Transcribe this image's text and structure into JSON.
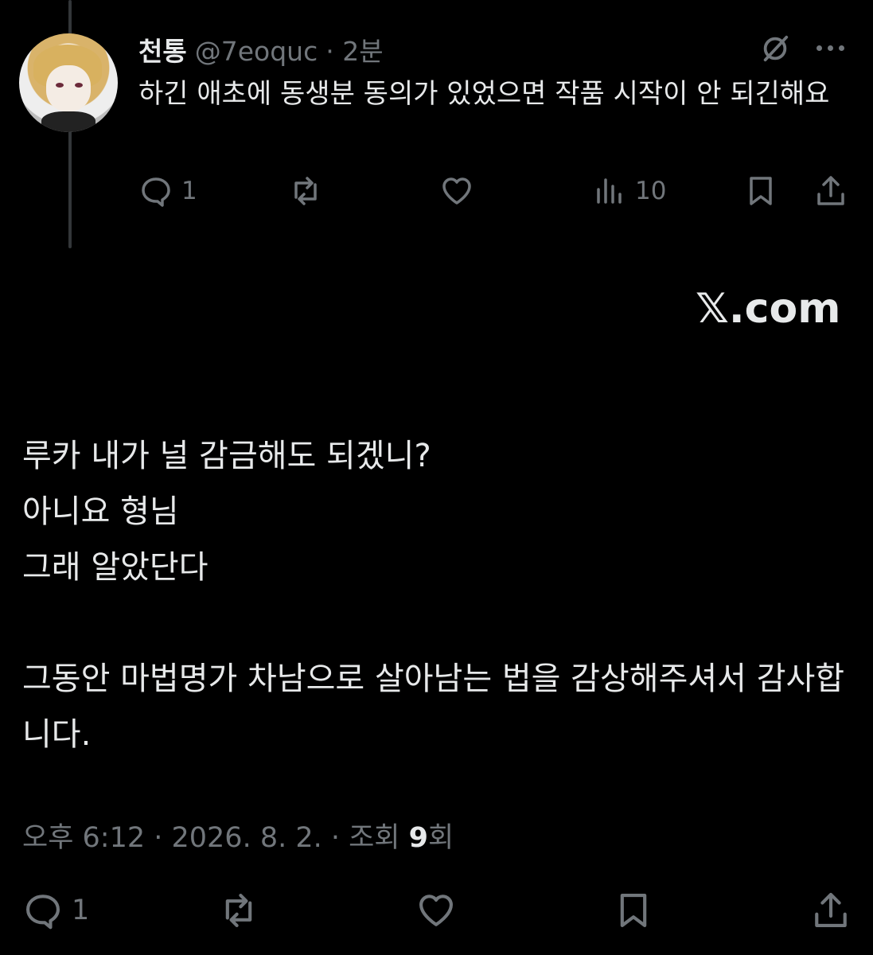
{
  "reply": {
    "display_name": "천통",
    "handle": "@7eoquc",
    "time": "· 2분",
    "text": "하긴 애초에 동생분 동의가 있었으면 작품 시작이 안 되긴해요",
    "actions": {
      "reply_count": "1",
      "retweet_count": "",
      "like_count": "",
      "view_count": "10"
    }
  },
  "watermark": "𝕏.com",
  "main": {
    "lines": [
      "루카 내가 널 감금해도 되겠니?",
      "아니요 형님",
      "그래 알았단다",
      "그동안 마법명가 차남으로 살아남는 법을 감상해주셔서 감사합니다."
    ],
    "meta_prefix": "오후 6:12 · 2026. 8. 2. · 조회 ",
    "views": "9",
    "views_suffix": "회",
    "actions": {
      "reply_count": "1"
    }
  },
  "icons": [
    "grok-icon",
    "more-icon",
    "reply-icon",
    "retweet-icon",
    "like-icon",
    "views-icon",
    "bookmark-icon",
    "share-icon"
  ],
  "colors": {
    "background": "#000000",
    "text": "#e7e9ea",
    "muted": "#71767b",
    "thread_line": "#333639"
  }
}
